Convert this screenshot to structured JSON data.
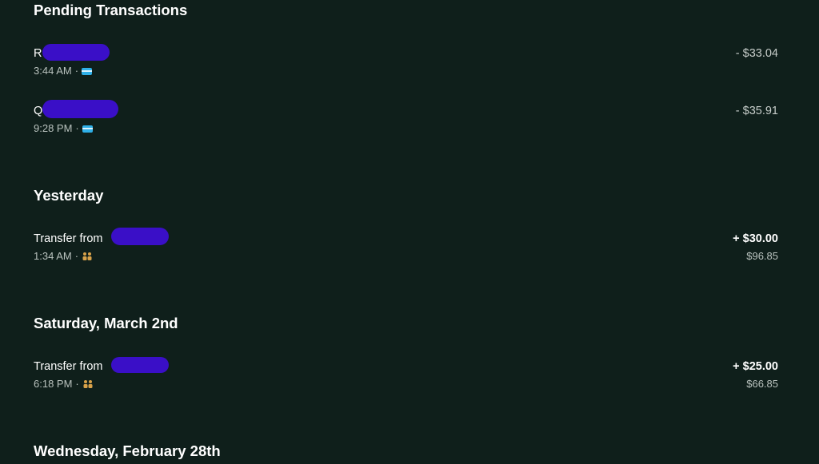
{
  "sections": {
    "pending": {
      "title": "Pending Transactions",
      "transactions": [
        {
          "name": "R",
          "time": "3:44 AM",
          "separator": "·",
          "icon": "card-icon",
          "amount": "- $33.04"
        },
        {
          "name": "Q",
          "time": "9:28 PM",
          "separator": "·",
          "icon": "card-icon",
          "amount": "- $35.91"
        }
      ]
    },
    "yesterday": {
      "title": "Yesterday",
      "transactions": [
        {
          "name": "Transfer from",
          "time": "1:34 AM",
          "separator": "·",
          "icon": "people-icon",
          "amount": "+ $30.00",
          "balance": "$96.85"
        }
      ]
    },
    "march2": {
      "title": "Saturday, March 2nd",
      "transactions": [
        {
          "name": "Transfer from",
          "time": "6:18 PM",
          "separator": "·",
          "icon": "people-icon",
          "amount": "+ $25.00",
          "balance": "$66.85"
        }
      ]
    },
    "feb28": {
      "title": "Wednesday, February 28th"
    }
  },
  "colors": {
    "background": "#0f1f1b",
    "redaction": "#3a0fc7",
    "card_icon": "#2fb0e8",
    "people_icon": "#d8a24a"
  }
}
